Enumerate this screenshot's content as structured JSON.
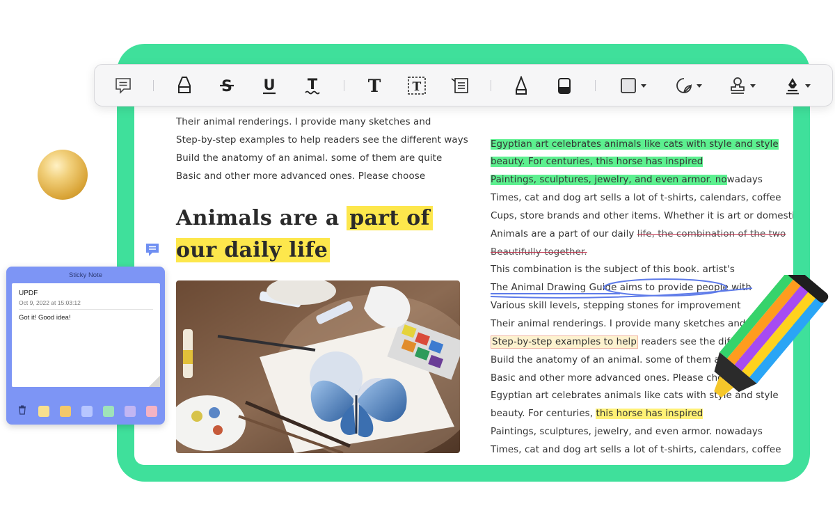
{
  "left_column": {
    "lines_top": [
      "Their animal renderings. I provide many sketches and",
      "Step-by-step examples to help readers see the different ways",
      "Build the anatomy of an animal. some of them are quite",
      "Basic and other more advanced ones. Please choose"
    ],
    "heading_line1_plain": "Animals are a ",
    "heading_line1_hl": "part of",
    "heading_line2_hl": "our daily life"
  },
  "right_column": {
    "g1": "Egyptian art celebrates animals like cats with style and style",
    "g2": "beauty. For centuries, this horse has inspired",
    "g3_hl": "Paintings, sculptures, jewelry, and even armor. no",
    "g3_rest": "wadays",
    "l4": "Times, cat and dog art sells a lot of t-shirts, calendars, coffee",
    "l5": "Cups, store brands and other items. Whether it is art or domestic",
    "l6_plain": "Animals are a part of our daily ",
    "l6_strike": "life, the combination of the two",
    "l7_strike": "Beautifully together.",
    "l8": "This combination is the subject of this book. artist's",
    "l9_ul": "The Animal Drawing Guide ",
    "l9_circled": "aims to provide people with",
    "l10": "Various skill levels, stepping stones for improvement",
    "l11": "Their animal renderings. I provide many sketches and",
    "l12_box": "Step-by-step examples to help",
    "l12_rest": " readers see the different ways",
    "l13": "Build the anatomy of an animal. some of them are quite",
    "l14": "Basic and other more advanced ones. Please choose",
    "l15": "Egyptian art celebrates animals like cats with style and style",
    "l16_plain": "beauty. For centuries, ",
    "l16_hl": "this horse has inspired",
    "l17": "Paintings, sculptures, jewelry, and even armor. nowadays",
    "l18": "Times, cat and dog art sells a lot of t-shirts, calendars, coffee"
  },
  "sticky_note": {
    "title": "Sticky Note",
    "author": "UPDF",
    "date": "Oct 9, 2022 at 15:03:12",
    "text": "Got it!  Good idea!",
    "swatches": [
      "#f8e08e",
      "#f3c86b",
      "#b7c6ff",
      "#9fe3b9",
      "#c2b6f3",
      "#f4b3c4"
    ]
  },
  "toolbar": {
    "tools": [
      "comment-icon",
      "highlight-pen-icon",
      "strikethrough-icon",
      "underline-icon",
      "squiggly-underline-icon",
      "text-icon",
      "text-box-icon",
      "text-callout-icon",
      "pencil-icon",
      "eraser-icon",
      "shape-icon",
      "sticker-icon",
      "stamp-icon",
      "signature-icon"
    ]
  },
  "colors": {
    "frame_green": "#3fe09b",
    "highlight_yellow": "#fde74c",
    "highlight_green": "#5cf08f",
    "sticky_blue": "#7d95f5",
    "ink_blue": "#5e7be9"
  }
}
